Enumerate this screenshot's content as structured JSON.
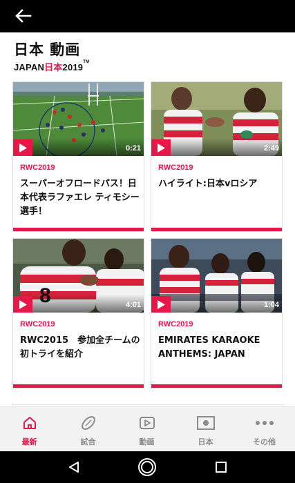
{
  "header": {
    "back_icon": "arrow-left-icon"
  },
  "page": {
    "title": "日本 動画",
    "brand_left": "JAPAN",
    "brand_jp": "日本",
    "brand_year": "2019",
    "brand_tm": "TM"
  },
  "videos": [
    {
      "tag": "RWC2019",
      "title": "スーパーオフロードパス！日本代表ラファエレ ティモシー選手！",
      "duration": "0:21"
    },
    {
      "tag": "RWC2019",
      "title": "ハイライト:日本vロシア",
      "duration": "2:49"
    },
    {
      "tag": "RWC2019",
      "title": "RWC2015　参加全チームの初トライを紹介",
      "duration": "4:01"
    },
    {
      "tag": "RWC2019",
      "title": "EMIRATES KARAOKE ANTHEMS: JAPAN",
      "duration": "1:04"
    }
  ],
  "nav": [
    {
      "label": "最新",
      "icon": "home-icon",
      "active": true
    },
    {
      "label": "試合",
      "icon": "rugby-ball-icon",
      "active": false
    },
    {
      "label": "動画",
      "icon": "play-video-icon",
      "active": false
    },
    {
      "label": "日本",
      "icon": "flag-icon",
      "active": false
    },
    {
      "label": "その他",
      "icon": "more-icon",
      "active": false
    }
  ],
  "colors": {
    "accent": "#e8174a",
    "nav_inactive": "#8a8a8a",
    "bar": "#000000"
  }
}
